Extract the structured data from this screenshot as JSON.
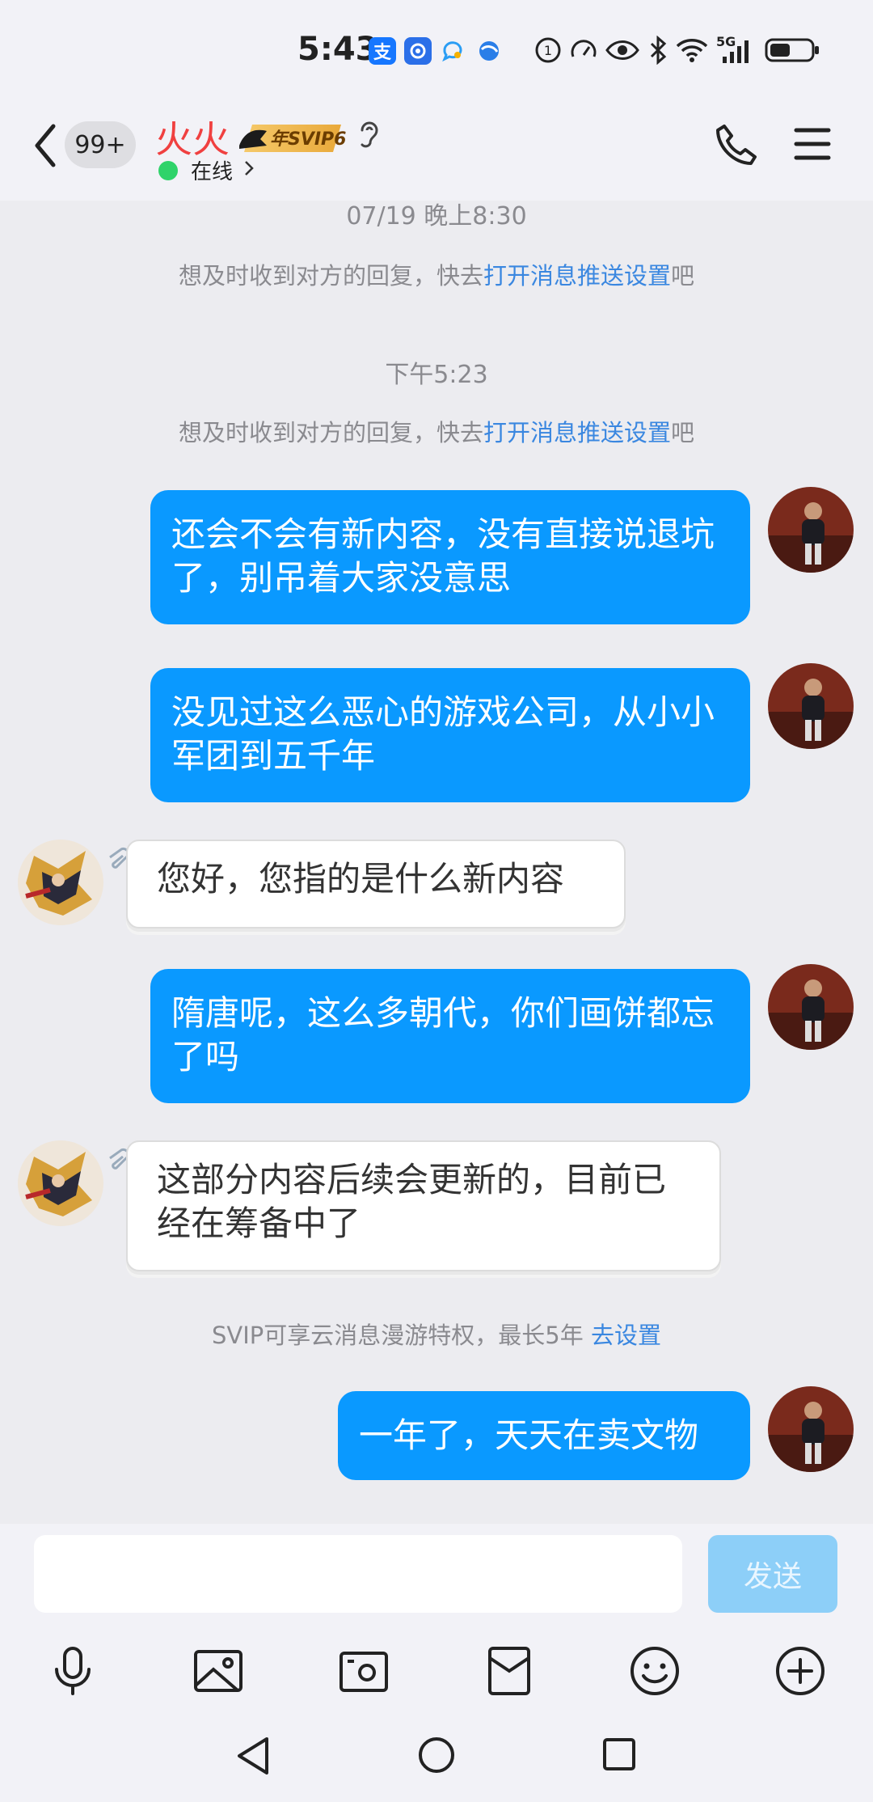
{
  "status_bar": {
    "time": "5:43",
    "app_icon_1": "支",
    "network_label": "5G",
    "icons": [
      "alipay-icon",
      "app-icon",
      "chat-app-icon",
      "browser-icon",
      "hd-icon",
      "speed-icon",
      "eye-icon",
      "bluetooth-icon",
      "wifi-icon",
      "signal-icon",
      "battery-icon"
    ]
  },
  "header": {
    "unread_badge": "99+",
    "contact_name": "火火",
    "vip_badge": "年SVIP6",
    "status": "在线",
    "accent": "#f04040"
  },
  "chat": {
    "timestamp_1": "07/19 晚上8:30",
    "notice_1": {
      "prefix": "想及时收到对方的回复，快去",
      "link": "打开消息推送设置",
      "suffix": "吧"
    },
    "timestamp_2": "下午5:23",
    "notice_2": {
      "prefix": "想及时收到对方的回复，快去",
      "link": "打开消息推送设置",
      "suffix": "吧"
    },
    "messages": [
      {
        "side": "out",
        "text": "还会不会有新内容，没有直接说退坑了，别吊着大家没意思"
      },
      {
        "side": "out",
        "text": "没见过这么恶心的游戏公司，从小小军团到五千年"
      },
      {
        "side": "in",
        "text": "您好，您指的是什么新内容"
      },
      {
        "side": "out",
        "text": "隋唐呢，这么多朝代，你们画饼都忘了吗"
      },
      {
        "side": "in",
        "text": "这部分内容后续会更新的，目前已经在筹备中了"
      },
      {
        "side": "out",
        "text": "一年了，天天在卖文物"
      }
    ],
    "svip_notice": {
      "text": "SVIP可享云消息漫游特权，最长5年 ",
      "link": "去设置"
    },
    "link_color": "#3a87e0",
    "bubble_color": "#0a99ff"
  },
  "input": {
    "value": "",
    "send_label": "发送"
  },
  "toolbar": [
    "microphone-icon",
    "image-icon",
    "camera-icon",
    "red-packet-icon",
    "emoji-icon",
    "plus-icon"
  ]
}
